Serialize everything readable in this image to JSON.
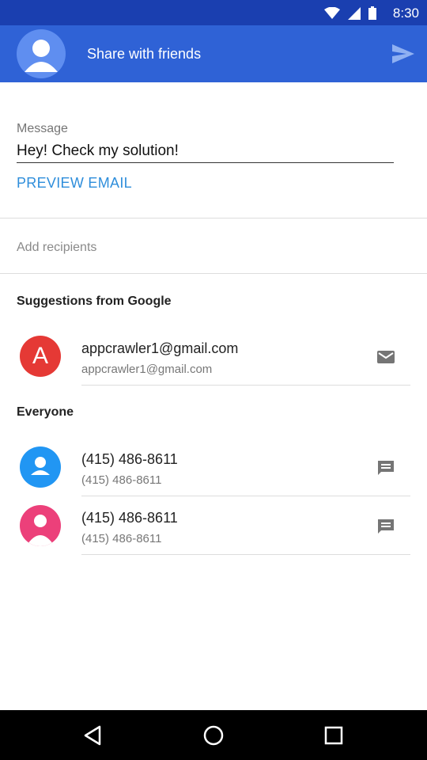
{
  "status_bar": {
    "time": "8:30"
  },
  "app_bar": {
    "title": "Share with friends"
  },
  "message": {
    "label": "Message",
    "value": "Hey! Check my solution!"
  },
  "preview_label": "PREVIEW EMAIL",
  "recipients": {
    "placeholder": "Add recipients"
  },
  "suggestions": {
    "title": "Suggestions from Google",
    "items": [
      {
        "initial": "A",
        "primary": "appcrawler1@gmail.com",
        "secondary": "appcrawler1@gmail.com",
        "avatar_color": "#e53935",
        "action_icon": "email-icon"
      }
    ]
  },
  "everyone": {
    "title": "Everyone",
    "items": [
      {
        "primary": "(415) 486-8611",
        "secondary": "(415) 486-8611",
        "avatar_color": "#2196f3",
        "action_icon": "message-icon"
      },
      {
        "primary": "(415) 486-8611",
        "secondary": "(415) 486-8611",
        "avatar_color": "#ec407a",
        "action_icon": "message-icon"
      }
    ]
  },
  "colors": {
    "status_bar": "#1a3fb0",
    "app_bar": "#2f62d6",
    "accent": "#2f8edb"
  }
}
